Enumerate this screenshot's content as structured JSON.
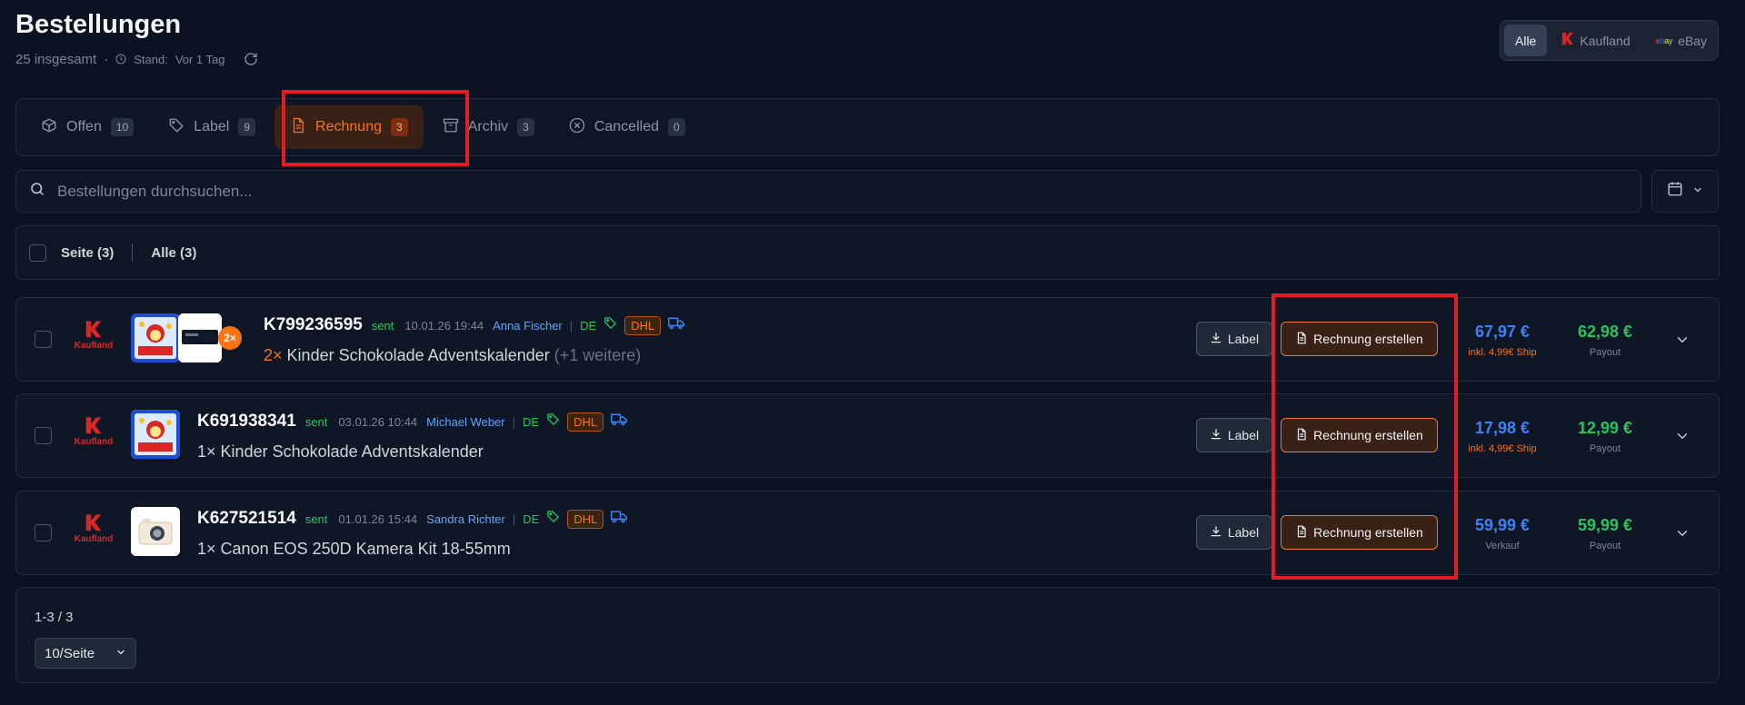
{
  "header": {
    "title": "Bestellungen",
    "total": "25 insgesamt",
    "separator": "·",
    "stand_label": "Stand:",
    "stand_value": "Vor 1 Tag"
  },
  "marketplace": {
    "options": [
      {
        "label": "Alle",
        "active": true
      },
      {
        "label": "Kaufland",
        "icon": "kaufland-icon",
        "active": false
      },
      {
        "label": "eBay",
        "icon": "ebay-icon",
        "active": false
      }
    ],
    "ebay_logo": "ebay"
  },
  "tabs": [
    {
      "label": "Offen",
      "count": "10",
      "icon": "box-icon",
      "active": false
    },
    {
      "label": "Label",
      "count": "9",
      "icon": "tag-icon",
      "active": false
    },
    {
      "label": "Rechnung",
      "count": "3",
      "icon": "document-icon",
      "active": true
    },
    {
      "label": "Archiv",
      "count": "3",
      "icon": "archive-icon",
      "active": false
    },
    {
      "label": "Cancelled",
      "count": "0",
      "icon": "x-circle-icon",
      "active": false
    }
  ],
  "search": {
    "placeholder": "Bestellungen durchsuchen..."
  },
  "selection": {
    "page_label": "Seite (3)",
    "all_label": "Alle (3)"
  },
  "kaufland_word": "Kaufland",
  "orders": [
    {
      "id": "K799236595",
      "status": "sent",
      "date": "10.01.26 19:44",
      "customer": "Anna Fischer",
      "country": "DE",
      "carrier": "DHL",
      "qty": "2×",
      "product": "Kinder Schokolade Adventskalender",
      "more": "(+1 weitere)",
      "thumb_badge": "2×",
      "label_btn": "Label",
      "invoice_btn": "Rechnung erstellen",
      "price": "67,97 €",
      "price_sub": "inkl. 4,99€ Ship",
      "payout": "62,98 €",
      "payout_sub": "Payout"
    },
    {
      "id": "K691938341",
      "status": "sent",
      "date": "03.01.26 10:44",
      "customer": "Michael Weber",
      "country": "DE",
      "carrier": "DHL",
      "qty": "1×",
      "product": "Kinder Schokolade Adventskalender",
      "label_btn": "Label",
      "invoice_btn": "Rechnung erstellen",
      "price": "17,98 €",
      "price_sub": "inkl. 4,99€ Ship",
      "payout": "12,99 €",
      "payout_sub": "Payout"
    },
    {
      "id": "K627521514",
      "status": "sent",
      "date": "01.01.26 15:44",
      "customer": "Sandra Richter",
      "country": "DE",
      "carrier": "DHL",
      "qty": "1×",
      "product": "Canon EOS 250D Kamera Kit 18-55mm",
      "label_btn": "Label",
      "invoice_btn": "Rechnung erstellen",
      "price": "59,99 €",
      "price_sub": "Verkauf",
      "payout": "59,99 €",
      "payout_sub": "Payout"
    }
  ],
  "pagination": {
    "range": "1-3 / 3",
    "per_page": "10/Seite"
  },
  "colors": {
    "accent": "#f97316",
    "highlight": "#e11d24",
    "price": "#3b82f6",
    "payout": "#22c55e",
    "customer": "#60a5fa"
  }
}
